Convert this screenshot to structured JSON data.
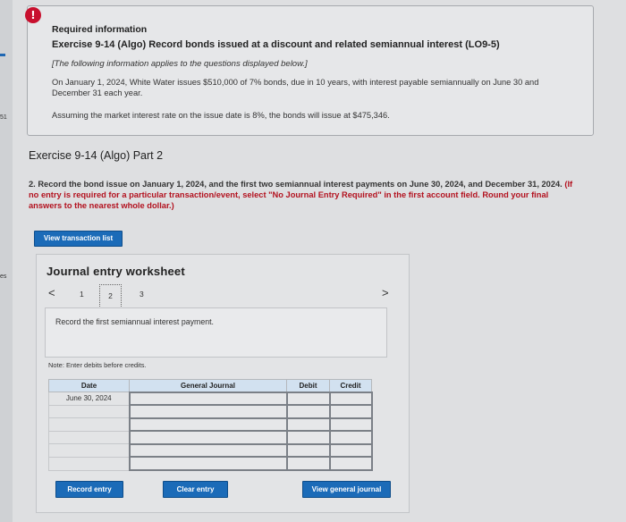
{
  "info": {
    "alert_glyph": "!",
    "required": "Required information",
    "exercise_title": "Exercise 9-14 (Algo) Record bonds issued at a discount and related semiannual interest (LO9-5)",
    "following": "[The following information applies to the questions displayed below.]",
    "para1": "On January 1, 2024, White Water issues $510,000 of 7% bonds, due in 10 years, with interest payable semiannually on June 30 and December 31 each year.",
    "para2": "Assuming the market interest rate on the issue date is 8%, the bonds will issue at $475,346."
  },
  "left_edge": {
    "num1": "51",
    "num2": "es"
  },
  "part_title": "Exercise 9-14 (Algo) Part 2",
  "instructions": {
    "lead": "2. Record the bond issue on January 1, 2024, and the first two semiannual interest payments on June 30, 2024, and December 31, 2024.",
    "bold": "(If no entry is required for a particular transaction/event, select \"No Journal Entry Required\" in the first account field. Round your final answers to the nearest whole dollar.)"
  },
  "buttons": {
    "view_transactions": "View transaction list",
    "record_entry": "Record entry",
    "clear_entry": "Clear entry",
    "view_general_journal": "View general journal"
  },
  "worksheet": {
    "title": "Journal entry worksheet",
    "prev": "<",
    "next": ">",
    "pages": [
      "1",
      "2",
      "3"
    ],
    "current_page": "2",
    "task": "Record the first semiannual interest payment.",
    "note": "Note: Enter debits before credits.",
    "columns": [
      "Date",
      "General Journal",
      "Debit",
      "Credit"
    ],
    "date_value": "June 30, 2024"
  },
  "colors": {
    "button": "#1b6bb8",
    "alert": "#c8102e",
    "header": "#d2e1f0"
  }
}
